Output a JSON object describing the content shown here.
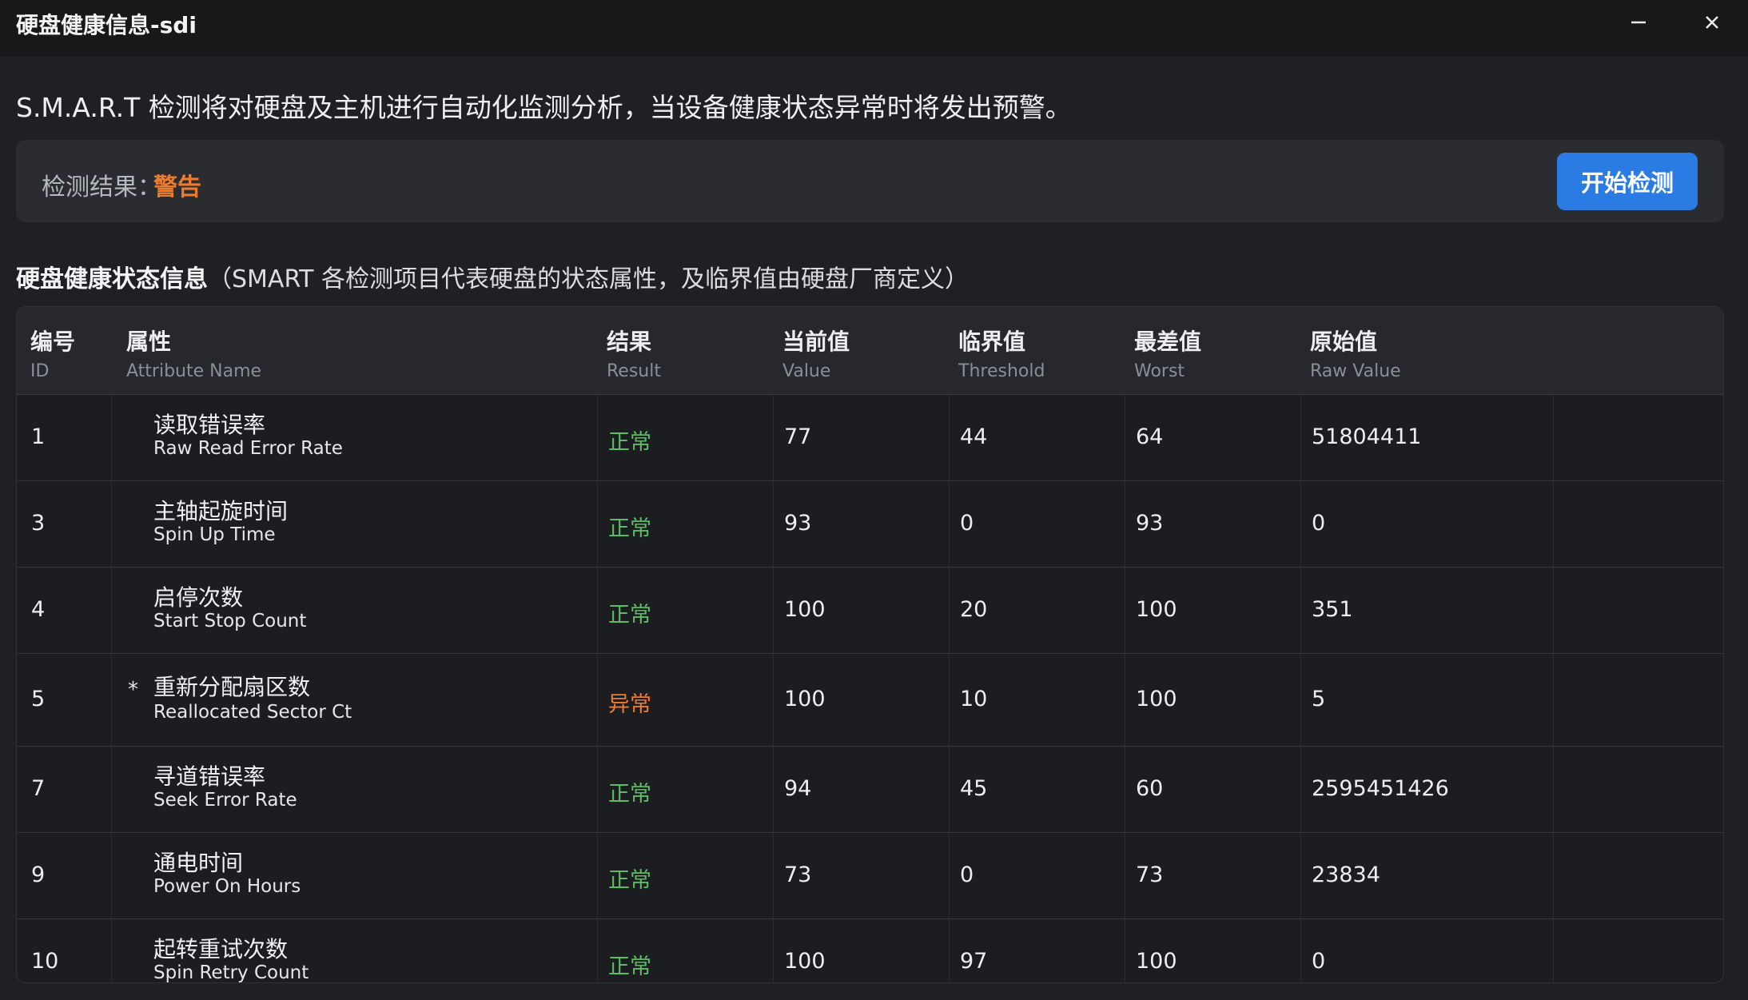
{
  "window": {
    "title": "硬盘健康信息-sdi",
    "minimize_icon": "minimize-icon",
    "close_icon": "close-icon"
  },
  "intro_text": "S.M.A.R.T 检测将对硬盘及主机进行自动化监测分析，当设备健康状态异常时将发出预警。",
  "result": {
    "label": "检测结果：",
    "value": "警告",
    "value_color": "#ea7b2f",
    "start_button_label": "开始检测"
  },
  "section": {
    "title": "硬盘健康状态信息",
    "note": "（SMART 各检测项目代表硬盘的状态属性，及临界值由硬盘厂商定义）"
  },
  "columns": {
    "id": {
      "zh": "编号",
      "en": "ID"
    },
    "attr": {
      "zh": "属性",
      "en": "Attribute Name"
    },
    "result": {
      "zh": "结果",
      "en": "Result"
    },
    "value": {
      "zh": "当前值",
      "en": "Value"
    },
    "threshold": {
      "zh": "临界值",
      "en": "Threshold"
    },
    "worst": {
      "zh": "最差值",
      "en": "Worst"
    },
    "raw": {
      "zh": "原始值",
      "en": "Raw Value"
    }
  },
  "status_colors": {
    "normal": "#5dbb63",
    "abnormal": "#ea7b2f"
  },
  "rows": [
    {
      "id": "1",
      "flag": "",
      "name_zh": "读取错误率",
      "name_en": "Raw Read Error Rate",
      "result": "正常",
      "status": "normal",
      "value": "77",
      "threshold": "44",
      "worst": "64",
      "raw": "51804411"
    },
    {
      "id": "3",
      "flag": "",
      "name_zh": "主轴起旋时间",
      "name_en": "Spin Up Time",
      "result": "正常",
      "status": "normal",
      "value": "93",
      "threshold": "0",
      "worst": "93",
      "raw": "0"
    },
    {
      "id": "4",
      "flag": "",
      "name_zh": "启停次数",
      "name_en": "Start Stop Count",
      "result": "正常",
      "status": "normal",
      "value": "100",
      "threshold": "20",
      "worst": "100",
      "raw": "351"
    },
    {
      "id": "5",
      "flag": "*",
      "name_zh": "重新分配扇区数",
      "name_en": "Reallocated Sector Ct",
      "result": "异常",
      "status": "abnormal",
      "value": "100",
      "threshold": "10",
      "worst": "100",
      "raw": "5"
    },
    {
      "id": "7",
      "flag": "",
      "name_zh": "寻道错误率",
      "name_en": "Seek Error Rate",
      "result": "正常",
      "status": "normal",
      "value": "94",
      "threshold": "45",
      "worst": "60",
      "raw": "2595451426"
    },
    {
      "id": "9",
      "flag": "",
      "name_zh": "通电时间",
      "name_en": "Power On Hours",
      "result": "正常",
      "status": "normal",
      "value": "73",
      "threshold": "0",
      "worst": "73",
      "raw": "23834"
    },
    {
      "id": "10",
      "flag": "",
      "name_zh": "起转重试次数",
      "name_en": "Spin Retry Count",
      "result": "正常",
      "status": "normal",
      "value": "100",
      "threshold": "97",
      "worst": "100",
      "raw": "0"
    }
  ]
}
